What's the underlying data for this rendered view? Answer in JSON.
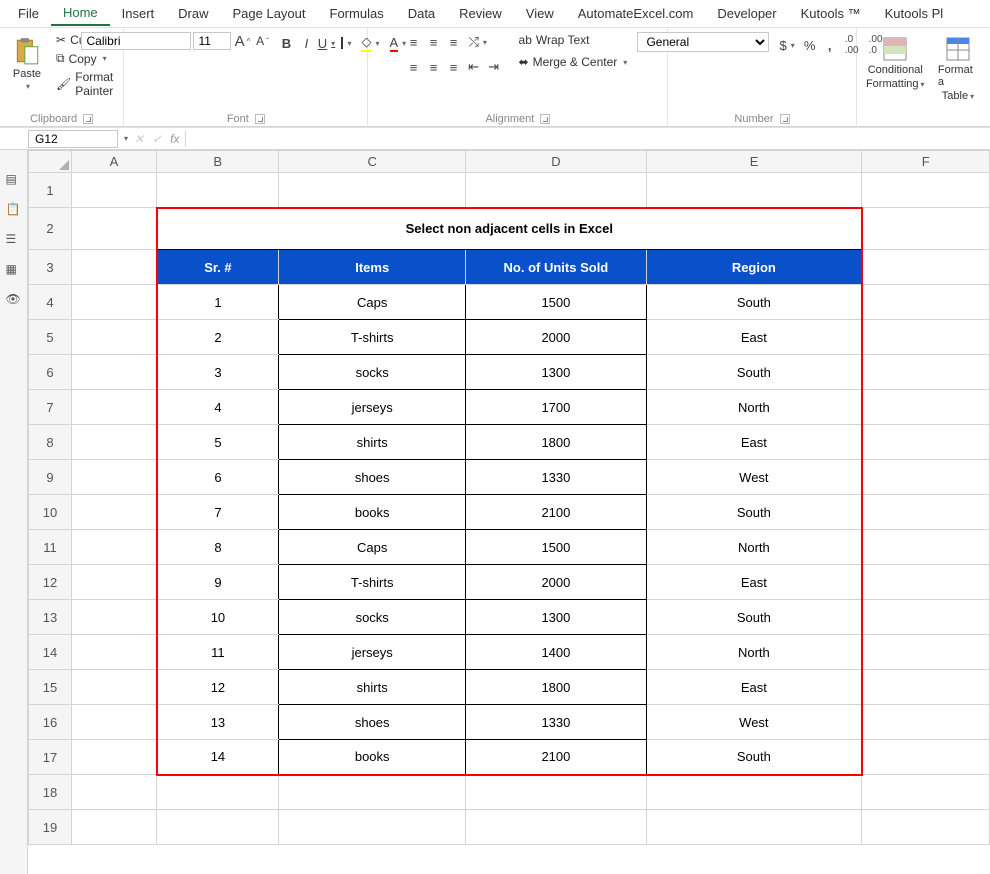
{
  "tabs": {
    "file": "File",
    "home": "Home",
    "insert": "Insert",
    "draw": "Draw",
    "page_layout": "Page Layout",
    "formulas": "Formulas",
    "data": "Data",
    "review": "Review",
    "view": "View",
    "automate": "AutomateExcel.com",
    "developer": "Developer",
    "kutools": "Kutools ™",
    "kutoolsp": "Kutools Pl"
  },
  "clipboard": {
    "paste": "Paste",
    "cut": "Cut",
    "copy": "Copy",
    "format_painter": "Format Painter",
    "group_label": "Clipboard"
  },
  "font": {
    "name": "Calibri",
    "size": "11",
    "bold": "B",
    "italic": "I",
    "underline": "U",
    "group_label": "Font",
    "increase": "A",
    "decrease": "A",
    "fill": "A",
    "color": "A"
  },
  "alignment": {
    "wrap": "Wrap Text",
    "merge": "Merge & Center",
    "group_label": "Alignment"
  },
  "number": {
    "format": "General",
    "currency": "$",
    "percent": "%",
    "comma": ",",
    "inc": ".00",
    "dec": ".0",
    "group_label": "Number"
  },
  "styles": {
    "cond": "Conditional",
    "cond2": "Formatting",
    "fmt": "Format a",
    "fmt2": "Table"
  },
  "namebox": "G12",
  "fx": "fx",
  "columns": [
    "A",
    "B",
    "C",
    "D",
    "E",
    "F"
  ],
  "rows": [
    "1",
    "2",
    "3",
    "4",
    "5",
    "6",
    "7",
    "8",
    "9",
    "10",
    "11",
    "12",
    "13",
    "14",
    "15",
    "16",
    "17",
    "18",
    "19"
  ],
  "title": "Select non adjacent cells in Excel",
  "headers": {
    "sr": "Sr. #",
    "items": "Items",
    "units": "No. of Units Sold",
    "region": "Region"
  },
  "data": [
    {
      "sr": "1",
      "item": "Caps",
      "units": "1500",
      "region": "South"
    },
    {
      "sr": "2",
      "item": "T-shirts",
      "units": "2000",
      "region": "East"
    },
    {
      "sr": "3",
      "item": "socks",
      "units": "1300",
      "region": "South"
    },
    {
      "sr": "4",
      "item": "jerseys",
      "units": "1700",
      "region": "North"
    },
    {
      "sr": "5",
      "item": "shirts",
      "units": "1800",
      "region": "East"
    },
    {
      "sr": "6",
      "item": "shoes",
      "units": "1330",
      "region": "West"
    },
    {
      "sr": "7",
      "item": "books",
      "units": "2100",
      "region": "South"
    },
    {
      "sr": "8",
      "item": "Caps",
      "units": "1500",
      "region": "North"
    },
    {
      "sr": "9",
      "item": "T-shirts",
      "units": "2000",
      "region": "East"
    },
    {
      "sr": "10",
      "item": "socks",
      "units": "1300",
      "region": "South"
    },
    {
      "sr": "11",
      "item": "jerseys",
      "units": "1400",
      "region": "North"
    },
    {
      "sr": "12",
      "item": "shirts",
      "units": "1800",
      "region": "East"
    },
    {
      "sr": "13",
      "item": "shoes",
      "units": "1330",
      "region": "West"
    },
    {
      "sr": "14",
      "item": "books",
      "units": "2100",
      "region": "South"
    }
  ]
}
